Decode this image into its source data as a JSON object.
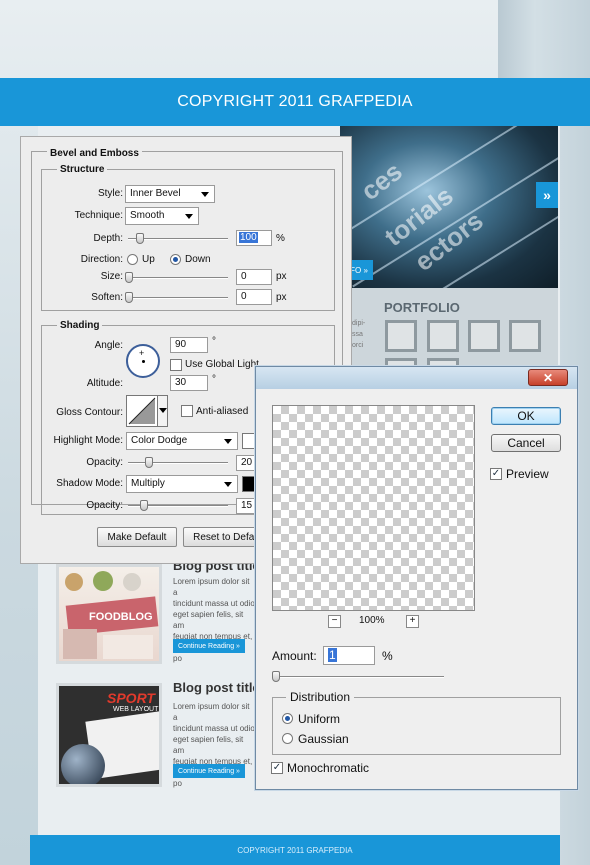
{
  "website": {
    "header_copyright": "COPYRIGHT 2011 GRAFPEDIA",
    "hero_words": [
      "ces",
      "torials",
      "ectors"
    ],
    "hero_next_arrow": "»",
    "hero_more_label": "FO »",
    "portfolio_title": "PORTFOLIO",
    "side_text": [
      "dipi-",
      "ssa",
      "orci"
    ],
    "posts": [
      {
        "title": "Blog post title",
        "body": [
          "Lorem ipsum dolor sit a",
          "tincidunt massa ut odio",
          "eget sapien felis, sit am",
          "feugiat non tempus et,",
          "orci vestibulum eget po"
        ],
        "button": "Continue Reading »",
        "thumb_label": "FOODBLOG"
      },
      {
        "title": "Blog post title",
        "body": [
          "Lorem ipsum dolor sit a",
          "tincidunt massa ut odio",
          "eget sapien felis, sit am",
          "feugiat non tempus et,",
          "orci vestibulum eget po"
        ],
        "button": "Continue Reading »",
        "thumb_label": "SPORT",
        "thumb_sublabel": "WEB LAYOUT"
      }
    ],
    "footer_copyright": "COPYRIGHT 2011 GRAFPEDIA"
  },
  "bevel_dialog": {
    "title": "Bevel and Emboss",
    "structure": {
      "heading": "Structure",
      "style_label": "Style:",
      "style_value": "Inner Bevel",
      "technique_label": "Technique:",
      "technique_value": "Smooth",
      "depth_label": "Depth:",
      "depth_value": "100",
      "depth_unit": "%",
      "direction_label": "Direction:",
      "direction_up": "Up",
      "direction_down": "Down",
      "direction_selected": "Down",
      "size_label": "Size:",
      "size_value": "0",
      "size_unit": "px",
      "soften_label": "Soften:",
      "soften_value": "0",
      "soften_unit": "px"
    },
    "shading": {
      "heading": "Shading",
      "angle_label": "Angle:",
      "angle_value": "90",
      "angle_unit": "°",
      "global_light_label": "Use Global Light",
      "global_light_checked": false,
      "altitude_label": "Altitude:",
      "altitude_value": "30",
      "altitude_unit": "°",
      "gloss_label": "Gloss Contour:",
      "anti_aliased_label": "Anti-aliased",
      "anti_aliased_checked": false,
      "highlight_mode_label": "Highlight Mode:",
      "highlight_mode_value": "Color Dodge",
      "highlight_color": "#ffffff",
      "highlight_opacity_label": "Opacity:",
      "highlight_opacity_value": "20",
      "highlight_opacity_unit": "%",
      "shadow_mode_label": "Shadow Mode:",
      "shadow_mode_value": "Multiply",
      "shadow_color": "#000000",
      "shadow_opacity_label": "Opacity:",
      "shadow_opacity_value": "15",
      "shadow_opacity_unit": "%"
    },
    "make_default": "Make Default",
    "reset_default": "Reset to Default"
  },
  "noise_dialog": {
    "close_glyph": "✕",
    "ok": "OK",
    "cancel": "Cancel",
    "preview_label": "Preview",
    "preview_checked": true,
    "zoom_minus": "−",
    "zoom_value": "100%",
    "zoom_plus": "+",
    "amount_label": "Amount:",
    "amount_value": "1",
    "amount_unit": "%",
    "distribution_heading": "Distribution",
    "uniform_label": "Uniform",
    "gaussian_label": "Gaussian",
    "distribution_selected": "Uniform",
    "monochromatic_label": "Monochromatic",
    "monochromatic_checked": true,
    "check_glyph": "✓"
  },
  "colors": {
    "brand_blue": "#1996d8",
    "selection_blue": "#2257a5",
    "close_red": "#c7412a"
  }
}
